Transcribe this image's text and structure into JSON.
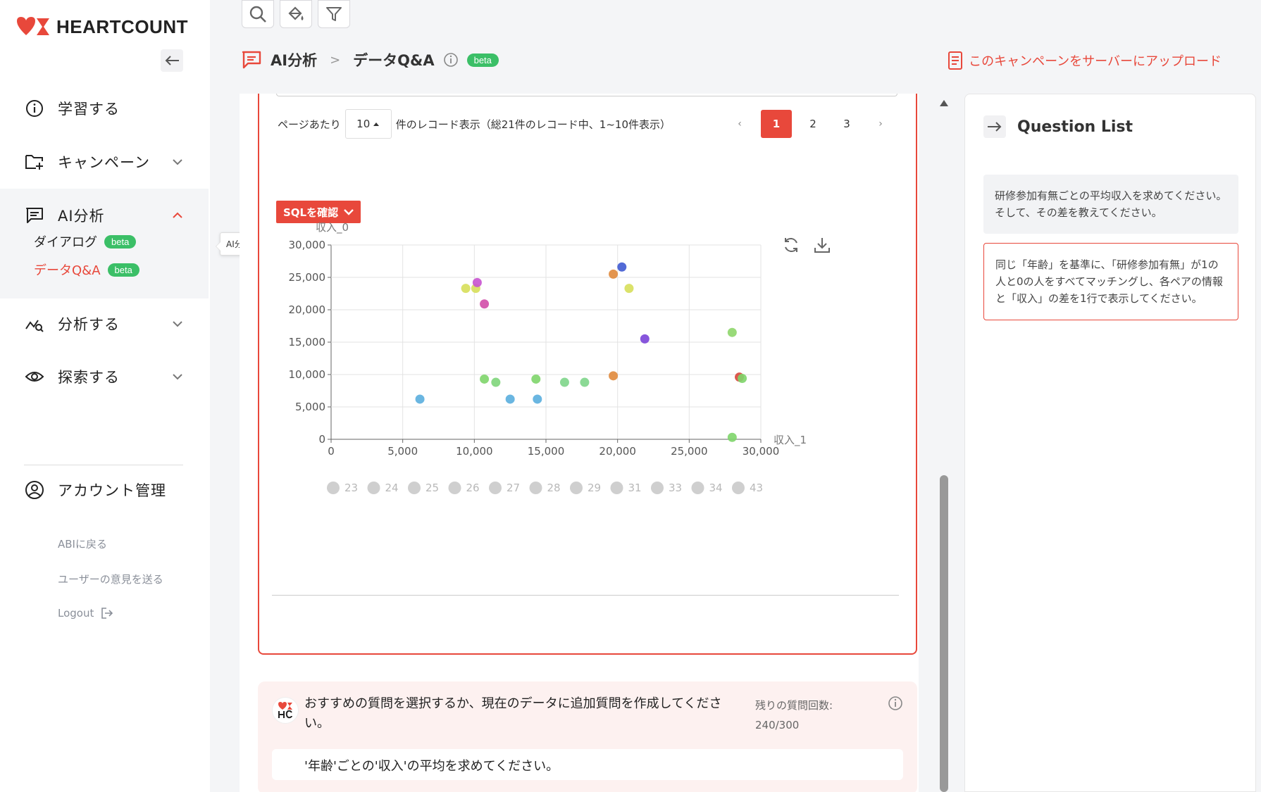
{
  "app": {
    "brand": "HEARTCOUNT",
    "accent_color": "#e8483b",
    "badge_color": "#3bbf67"
  },
  "sidebar": {
    "items": [
      {
        "label": "学習する",
        "icon": "info-circle-icon"
      },
      {
        "label": "キャンペーン",
        "icon": "folder-plus-icon"
      },
      {
        "label": "AI分析",
        "icon": "chat-icon"
      },
      {
        "label": "分析する",
        "icon": "analytics-icon"
      },
      {
        "label": "探索する",
        "icon": "eye-icon"
      }
    ],
    "sub_items": [
      {
        "label": "ダイアログ",
        "badge": "beta"
      },
      {
        "label": "データQ&A",
        "badge": "beta",
        "active": true
      }
    ],
    "account": "アカウント管理",
    "links": {
      "back": "ABIに戻る",
      "feedback": "ユーザーの意見を送る",
      "logout": "Logout"
    }
  },
  "tooltip": "AI分析",
  "header": {
    "crumb1": "AI分析",
    "sep": ">",
    "crumb2": "データQ&A",
    "badge": "beta",
    "upload": "このキャンペーンをサーバーにアップロード"
  },
  "pager": {
    "prefix": "ページあたり",
    "page_size": "10",
    "suffix": "件のレコード表示（総21件のレコード中、1~10件表示）",
    "prev": "‹",
    "next": "›",
    "pages": [
      "1",
      "2",
      "3"
    ],
    "current": "1"
  },
  "sql_button": "SQLを確認",
  "chart_data": {
    "type": "scatter",
    "ylabel": "収入_0",
    "xlabel": "収入_1",
    "xlim": [
      0,
      30000
    ],
    "ylim": [
      0,
      30000
    ],
    "x_ticks": [
      "0",
      "5,000",
      "10,000",
      "15,000",
      "20,000",
      "25,000",
      "30,000"
    ],
    "y_ticks": [
      "0",
      "5,000",
      "10,000",
      "15,000",
      "20,000",
      "25,000",
      "30,000"
    ],
    "grid": true,
    "legend": [
      "23",
      "24",
      "25",
      "26",
      "27",
      "28",
      "29",
      "31",
      "33",
      "34",
      "43"
    ],
    "legend_placement": "bottom",
    "points": [
      {
        "x": 6200,
        "y": 6200,
        "color": "#5aaede"
      },
      {
        "x": 9400,
        "y": 23300,
        "color": "#d7df5a"
      },
      {
        "x": 10100,
        "y": 23300,
        "color": "#d7df5a"
      },
      {
        "x": 10200,
        "y": 24200,
        "color": "#c853cf"
      },
      {
        "x": 10700,
        "y": 20900,
        "color": "#d24ca8"
      },
      {
        "x": 10700,
        "y": 9300,
        "color": "#7ed56a"
      },
      {
        "x": 11500,
        "y": 8800,
        "color": "#7ed57a"
      },
      {
        "x": 12500,
        "y": 6200,
        "color": "#5aaede"
      },
      {
        "x": 14300,
        "y": 9300,
        "color": "#7ed56a"
      },
      {
        "x": 14400,
        "y": 6200,
        "color": "#5aaede"
      },
      {
        "x": 16300,
        "y": 8800,
        "color": "#7ed58a"
      },
      {
        "x": 17700,
        "y": 8800,
        "color": "#7ed58a"
      },
      {
        "x": 19700,
        "y": 25500,
        "color": "#e08a3c"
      },
      {
        "x": 19700,
        "y": 9800,
        "color": "#e08a3c"
      },
      {
        "x": 20300,
        "y": 26600,
        "color": "#3f5ad2"
      },
      {
        "x": 20800,
        "y": 23300,
        "color": "#d7df5a"
      },
      {
        "x": 21900,
        "y": 15500,
        "color": "#7a44d8"
      },
      {
        "x": 28000,
        "y": 16500,
        "color": "#8ed66a"
      },
      {
        "x": 28500,
        "y": 9600,
        "color": "#d8473c"
      },
      {
        "x": 28700,
        "y": 9400,
        "color": "#7ed56a"
      },
      {
        "x": 28000,
        "y": 300,
        "color": "#7ed56a"
      }
    ]
  },
  "suggest": {
    "text": "おすすめの質問を選択するか、現在のデータに追加質問を作成してください。",
    "remain_label": "残りの質問回数:",
    "remain_value": "240/300",
    "chip": "'年齢'ごとの'収入'の平均を求めてください。"
  },
  "questions": {
    "title": "Question List",
    "items": [
      "研修参加有無ごとの平均収入を求めてください。そして、その差を教えてください。",
      "同じ「年齢」を基準に、「研修参加有無」が1の人と0の人をすべてマッチングし、各ペアの情報と「収入」の差を1行で表示してください。"
    ]
  }
}
